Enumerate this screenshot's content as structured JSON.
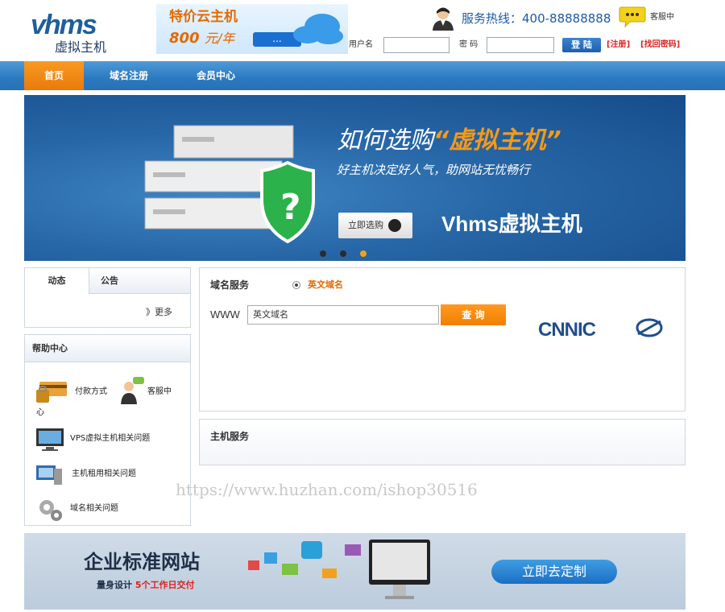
{
  "header": {
    "logo_mark": "vhms",
    "logo_text": "虚拟主机",
    "promo": {
      "title": "特价云主机",
      "price": "800",
      "unit": "元/年",
      "button": "..."
    },
    "hotline": "服务热线：400-88888888",
    "service": "客服中",
    "login": {
      "username_label": "用户名",
      "password_label": "密 码",
      "login_button": "登 陆",
      "register_link": "[注册]",
      "forgot_link": "[找回密码]"
    }
  },
  "nav": {
    "items": [
      {
        "label": "首页",
        "active": true
      },
      {
        "label": "域名注册",
        "active": false
      },
      {
        "label": "会员中心",
        "active": false
      }
    ]
  },
  "banner": {
    "title_prefix": "如何选购",
    "title_highlight": "“虚拟主机”",
    "subtitle": "好主机决定好人气，助网站无忧畅行",
    "button": "立即选购",
    "brand": "Vhms虚拟主机",
    "slides": 3,
    "active_slide": 3
  },
  "news": {
    "tabs": [
      "动态",
      "公告"
    ],
    "more": "》更多"
  },
  "help": {
    "title": "帮助中心",
    "items": [
      {
        "label": "付款方式",
        "icon": "payment-icon"
      },
      {
        "label": "客服中",
        "icon": "customer-service-icon"
      },
      {
        "label": "心",
        "icon": ""
      },
      {
        "label": "VPS虚拟主机相关问题",
        "icon": "monitor-icon"
      },
      {
        "label": "主机租用相关问题",
        "icon": "computer-icon"
      },
      {
        "label": "域名相关问题",
        "icon": "gears-icon"
      }
    ]
  },
  "domain_service": {
    "title": "域名服务",
    "radio_label": "英文域名",
    "prefix": "WWW",
    "input_value": "英文域名",
    "button": "查 询",
    "logo_text": "CNNIC"
  },
  "host_service": {
    "title": "主机服务"
  },
  "watermark": "https://www.huzhan.com/ishop30516",
  "bottom_banner": {
    "title": "企业标准网站",
    "sub_prefix": "量身设计",
    "sub_highlight": "5个工作日交付",
    "button": "立即去定制"
  },
  "colors": {
    "brand_blue": "#2b79c0",
    "accent_orange": "#f07f00",
    "link_red": "#dd2222"
  }
}
